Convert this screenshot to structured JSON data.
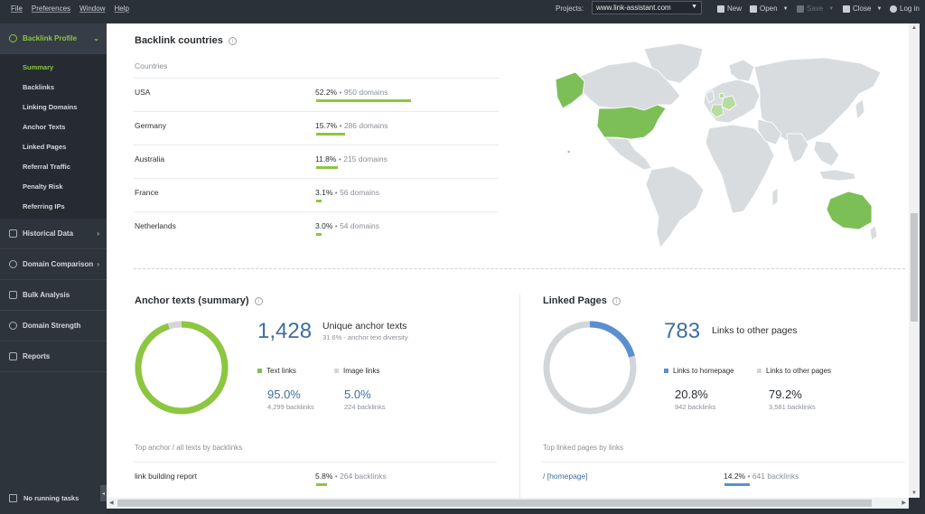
{
  "menu": [
    "File",
    "Preferences",
    "Window",
    "Help"
  ],
  "toolbar": {
    "projects_label": "Projects:",
    "project_value": "www.link-assistant.com",
    "new_label": "New",
    "open_label": "Open",
    "save_label": "Save",
    "close_label": "Close",
    "login_label": "Log in"
  },
  "sidebar": {
    "backlink_profile": "Backlink Profile",
    "subitems": [
      "Summary",
      "Backlinks",
      "Linking Domains",
      "Anchor Texts",
      "Linked Pages",
      "Referral Traffic",
      "Penalty Risk",
      "Referring IPs"
    ],
    "historical_data": "Historical Data",
    "domain_comparison": "Domain Comparison",
    "bulk_analysis": "Bulk Analysis",
    "domain_strength": "Domain Strength",
    "reports": "Reports",
    "no_running_tasks": "No running tasks"
  },
  "countries": {
    "title": "Backlink countries",
    "column_header": "Countries",
    "rows": [
      {
        "name": "USA",
        "pct": "52.2%",
        "domains": "950 domains",
        "value": 52.2
      },
      {
        "name": "Germany",
        "pct": "15.7%",
        "domains": "286 domains",
        "value": 15.7
      },
      {
        "name": "Australia",
        "pct": "11.8%",
        "domains": "215 domains",
        "value": 11.8
      },
      {
        "name": "France",
        "pct": "3.1%",
        "domains": "56 domains",
        "value": 3.1
      },
      {
        "name": "Netherlands",
        "pct": "3.0%",
        "domains": "54 domains",
        "value": 3.0
      }
    ]
  },
  "anchor": {
    "title": "Anchor texts (summary)",
    "count": "1,428",
    "count_label": "Unique anchor texts",
    "diversity": "31.6% - anchor text diversity",
    "legend_text": "Text links",
    "legend_image": "Image links",
    "text_pct": "95.0%",
    "text_backlinks": "4,299 backlinks",
    "image_pct": "5.0%",
    "image_backlinks": "224 backlinks",
    "text_value": 95.0,
    "list_title": "Top anchor / all texts by backlinks",
    "list_row": {
      "name": "link building report",
      "pct": "5.8%",
      "backlinks": "264 backlinks",
      "value": 5.8
    }
  },
  "linked": {
    "title": "Linked Pages",
    "count": "783",
    "count_label": "Links to other pages",
    "legend_home": "Links to homepage",
    "legend_other": "Links to other pages",
    "home_pct": "20.8%",
    "home_backlinks": "942 backlinks",
    "other_pct": "79.2%",
    "other_backlinks": "3,581 backlinks",
    "home_value": 20.8,
    "list_title": "Top linked pages by links",
    "list_row": {
      "name": "/ [homepage]",
      "pct": "14.2%",
      "backlinks": "641 backlinks",
      "value": 14.2
    }
  },
  "colors": {
    "green": "#8dc63f",
    "blue": "#5b8fcf",
    "gray": "#d3d6d9",
    "map_gray": "#d9dcdf"
  }
}
